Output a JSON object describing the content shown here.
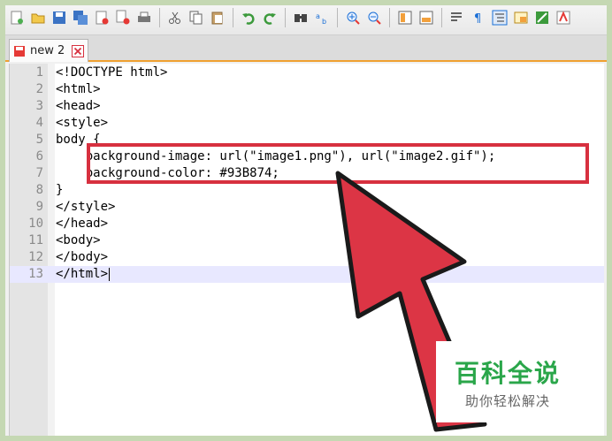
{
  "toolbar": {
    "icons": [
      "new-file",
      "open-file",
      "save",
      "save-all",
      "close",
      "close-all",
      "print",
      "cut",
      "copy",
      "paste",
      "undo",
      "redo",
      "find",
      "replace",
      "zoom-in",
      "zoom-out",
      "sync-vertical",
      "sync-horizontal",
      "word-wrap",
      "show-all-chars",
      "indent-guide",
      "user-language",
      "document-map",
      "macro-record"
    ]
  },
  "tab": {
    "label": "new 2"
  },
  "editor": {
    "lines": [
      {
        "num": "1",
        "text": "<!DOCTYPE html>"
      },
      {
        "num": "2",
        "text": "<html>"
      },
      {
        "num": "3",
        "text": "<head>"
      },
      {
        "num": "4",
        "text": "<style>"
      },
      {
        "num": "5",
        "text": "body {"
      },
      {
        "num": "6",
        "text": "    background-image: url(\"image1.png\"), url(\"image2.gif\");"
      },
      {
        "num": "7",
        "text": "    background-color: #93B874;"
      },
      {
        "num": "8",
        "text": "}"
      },
      {
        "num": "9",
        "text": "</style>"
      },
      {
        "num": "10",
        "text": "</head>"
      },
      {
        "num": "11",
        "text": "<body>"
      },
      {
        "num": "12",
        "text": "</body>"
      },
      {
        "num": "13",
        "text": "</html>"
      }
    ]
  },
  "watermark": {
    "title": "百科全说",
    "subtitle": "助你轻松解决"
  },
  "colors": {
    "highlight": "#d7303f",
    "arrow": "#dc3545",
    "watermark_green": "#2aa64a"
  }
}
